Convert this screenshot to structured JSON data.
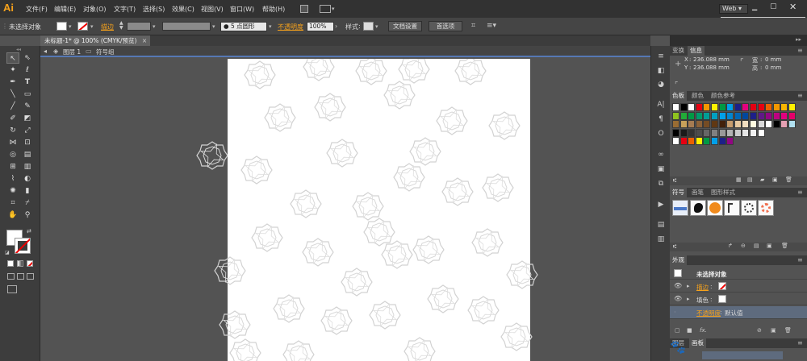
{
  "app": {
    "logo": "Ai"
  },
  "menubar": {
    "items": [
      "文件(F)",
      "编辑(E)",
      "对象(O)",
      "文字(T)",
      "选择(S)",
      "效果(C)",
      "视图(V)",
      "窗口(W)",
      "帮助(H)"
    ],
    "workspace": "Web",
    "ime_logo": "S"
  },
  "control_bar": {
    "selection": "未选择对象",
    "stroke_label": "描边",
    "brush": "5 点圆形",
    "opacity_label": "不透明度",
    "opacity_value": "100%",
    "style_label": "样式",
    "doc_setup_button": "文档设置",
    "prefs_button": "首选项"
  },
  "document": {
    "tab_title": "未标题-1* @ 100% (CMYK/预览)",
    "tab_close": "×",
    "breadcrumb": [
      "图层 1",
      "符号组"
    ]
  },
  "info_panel": {
    "tabs": [
      "变换",
      "信息"
    ],
    "x_label": "X",
    "x_value": "236.088 mm",
    "y_label": "Y",
    "y_value": "236.088 mm",
    "w_label": "宽",
    "w_value": "0 mm",
    "h_label": "高",
    "h_value": "0 mm"
  },
  "swatches_panel": {
    "tabs": [
      "色板",
      "颜色",
      "颜色参考"
    ],
    "rows": [
      [
        "#ffffff",
        "#000000",
        "#ffffff",
        "#e60012",
        "#f39800",
        "#fff100",
        "#009944",
        "#00a0e9",
        "#1d2088",
        "#e4007f",
        "#e60012",
        "#e60012",
        "#eb6100",
        "#f39800",
        "#f8b500",
        "#fff100"
      ],
      [
        "#8fc31f",
        "#22ac38",
        "#009944",
        "#009b6b",
        "#009e96",
        "#00a0c1",
        "#00a0e9",
        "#0086d1",
        "#0068b7",
        "#00479d",
        "#1d2088",
        "#601986",
        "#920783",
        "#be0081",
        "#e4007f",
        "#e5006a"
      ],
      [
        "#996c33",
        "#c7a15a",
        "#a67c52",
        "#8c6239",
        "#754c24",
        "#603813",
        "#42210b",
        "#c69c6d",
        "#e6c8a0",
        "#f0ddc0",
        "#fffbe0",
        "#d9d9d9",
        "#ffffff",
        "#000000",
        "#e5a0b3",
        "#b0e0f0"
      ],
      [
        "#000000",
        "#1a1a1a",
        "#333333",
        "#4d4d4d",
        "#666666",
        "#808080",
        "#999999",
        "#b3b3b3",
        "#cccccc",
        "#e6e6e6",
        "#f2f2f2",
        "#ffffff"
      ],
      [
        "#ffffff",
        "#e60012",
        "#eb6100",
        "#fff100",
        "#009944",
        "#00a0e9",
        "#1d2088",
        "#920783"
      ]
    ]
  },
  "symbols_panel": {
    "tabs": [
      "符号",
      "画笔",
      "图形样式"
    ]
  },
  "appearance_panel": {
    "title": "外观",
    "object": "未选择对象",
    "stroke_label": "描边",
    "fill_label": "填色",
    "opacity_label": "不透明度",
    "opacity_value": "默认值"
  },
  "bottom_panel": {
    "tabs": [
      "图层",
      "画板"
    ]
  },
  "colors": {
    "accent": "#f7a21b",
    "highlight": "#5678b4",
    "panel_bg": "#535353",
    "dark_bar": "#323232"
  }
}
